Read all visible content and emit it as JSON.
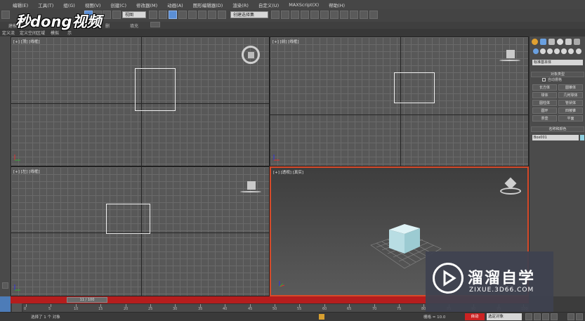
{
  "menubar": {
    "items": [
      "编辑(E)",
      "工具(T)",
      "组(G)",
      "视图(V)",
      "创建(C)",
      "修改器(M)",
      "动画(A)",
      "图形编辑器(D)",
      "渲染(R)",
      "自定义(U)",
      "MAXScript(X)",
      "帮助(H)"
    ]
  },
  "toolbar": {
    "view_dropdown": "视图",
    "selection_set_dropdown": "创建选择集"
  },
  "ribbon": {
    "fill_label": "填充",
    "item_a": "建模",
    "item_b": "删"
  },
  "tabs": [
    "定义流",
    "定义空间区域",
    "模拟",
    "示"
  ],
  "brand_watermark": "秒dong视频",
  "viewports": {
    "top": "[+] [顶] [线框]",
    "front": "[+] [前] [线框]",
    "left": "[+] [左] [线框]",
    "perspective": "[+] [透视] [真实]"
  },
  "command_panel": {
    "category_dropdown": "标准基本体",
    "object_type_header": "对象类型",
    "autogrid_label": "自动栅格",
    "buttons": [
      "长方体",
      "圆锥体",
      "球体",
      "几何球体",
      "圆柱体",
      "管状体",
      "圆环",
      "四棱锥",
      "茶壶",
      "平面"
    ],
    "name_color_header": "名称和颜色",
    "name_value": "Box001"
  },
  "timeline": {
    "slider_label": "11 / 100",
    "ticks": [
      "0",
      "5",
      "10",
      "15",
      "20",
      "25",
      "30",
      "35",
      "40",
      "45",
      "50",
      "55",
      "60",
      "65",
      "70",
      "75",
      "80",
      "85",
      "90",
      "95",
      "100"
    ]
  },
  "status": {
    "selection_text": "选择了 1 个 对象",
    "grid_text": "栅格 = 10.0",
    "auto_key_label": "自动",
    "selected_dropdown": "选定对象"
  },
  "watermark": {
    "title": "溜溜自学",
    "url": "ZIXUE.3D66.COM"
  },
  "colors": {
    "accent_red": "#b51d1d",
    "viewport_active_border": "#d64a2a",
    "selection_blue": "#5b8fd6"
  }
}
